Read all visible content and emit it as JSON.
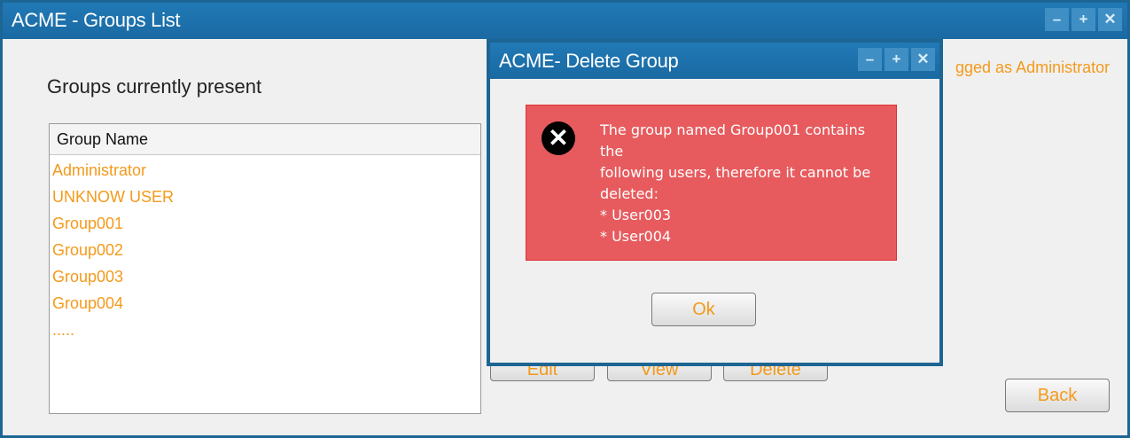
{
  "main_window": {
    "title": "ACME - Groups List",
    "window_buttons": [
      "–",
      "+",
      "✕"
    ],
    "logged_label": "gged as Administrator",
    "groups_label": "Groups currently present",
    "list": {
      "header": "Group Name",
      "items": [
        "Administrator",
        "UNKNOW USER",
        "Group001",
        "Group002",
        "Group003",
        "Group004",
        "....."
      ]
    },
    "edit_button": "Edit",
    "view_button": "View",
    "delete_button": "Delete",
    "back_button": "Back"
  },
  "dialog": {
    "title": "ACME- Delete Group",
    "window_buttons": [
      "–",
      "+",
      "✕"
    ],
    "error_icon": "✕",
    "message_lines": [
      "The group named Group001 contains the",
      "following users, therefore it cannot be",
      "deleted:",
      "* User003",
      "* User004"
    ],
    "ok_button": "Ok"
  }
}
